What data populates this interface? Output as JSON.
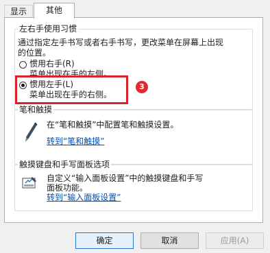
{
  "tabs": [
    {
      "label": "显示"
    },
    {
      "label": "其他"
    }
  ],
  "handedness": {
    "group_title": "左右手使用习惯",
    "description_line1": "通过指定左手书写或者右手书写，更改菜单在屏幕上出现",
    "description_line2": "的位置。",
    "right_option": {
      "label": "惯用右手(R)",
      "sub": "菜单出现在手的左侧。",
      "selected": false
    },
    "left_option": {
      "label": "惯用左手(L)",
      "sub": "菜单出现在手的右侧。",
      "selected": true
    }
  },
  "callout": {
    "number": "3",
    "color": "#e8262c"
  },
  "pen_touch": {
    "group_title": "笔和触摸",
    "description": "在“笔和触摸”中配置笔和触摸设置。",
    "link": "转到“笔和触摸”"
  },
  "touch_keyboard": {
    "group_title": "触摸键盘和手写面板选项",
    "description_line1": "自定义“输入面板设置”中的触摸键盘和手写",
    "description_line2": "面板功能。",
    "link": "转到“输入面板设置”"
  },
  "buttons": {
    "ok": "确定",
    "cancel": "取消",
    "apply": "应用(A)"
  },
  "colors": {
    "link": "#0050b8",
    "highlight": "#d9232a"
  }
}
